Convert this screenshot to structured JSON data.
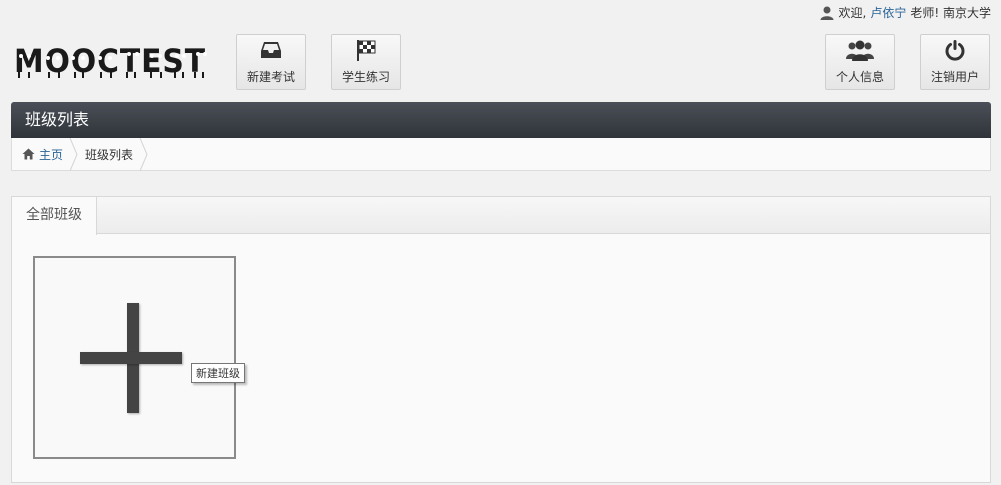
{
  "header": {
    "welcome_prefix": "欢迎,",
    "user_name": "卢依宁",
    "welcome_suffix": "老师! 南京大学",
    "logo_text": "MOOCTEST"
  },
  "toolbar": {
    "new_exam_label": "新建考试",
    "student_practice_label": "学生练习",
    "profile_label": "个人信息",
    "logout_label": "注销用户"
  },
  "page": {
    "title": "班级列表"
  },
  "breadcrumb": {
    "home_label": "主页",
    "current_label": "班级列表"
  },
  "main": {
    "tabs": [
      {
        "label": "全部班级"
      }
    ],
    "add_class_tooltip": "新建班级"
  },
  "colors": {
    "title_bar": "#3a3f46",
    "link": "#2a6496",
    "background": "#f1f1f1"
  }
}
